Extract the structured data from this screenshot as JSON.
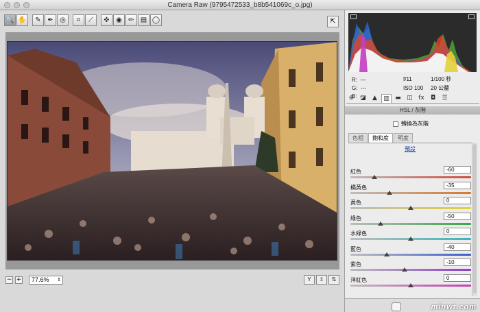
{
  "window": {
    "title": "Camera Raw (9795472533_b8b541069c_o.jpg)"
  },
  "toolbar": {
    "tools": [
      {
        "name": "zoom-tool",
        "glyph": "🔍",
        "active": true
      },
      {
        "name": "hand-tool",
        "glyph": "✋",
        "active": false
      },
      {
        "name": "white-balance-tool",
        "glyph": "✎",
        "active": false
      },
      {
        "name": "color-sampler-tool",
        "glyph": "✒",
        "active": false
      },
      {
        "name": "targeted-adjustment-tool",
        "glyph": "◎",
        "active": false
      },
      {
        "name": "crop-tool",
        "glyph": "⌗",
        "active": false
      },
      {
        "name": "straighten-tool",
        "glyph": "⟋",
        "active": false
      },
      {
        "name": "spot-removal-tool",
        "glyph": "✜",
        "active": false
      },
      {
        "name": "red-eye-tool",
        "glyph": "◉",
        "active": false
      },
      {
        "name": "adjustment-brush-tool",
        "glyph": "✏",
        "active": false
      },
      {
        "name": "graduated-filter-tool",
        "glyph": "▤",
        "active": false
      },
      {
        "name": "radial-filter-tool",
        "glyph": "◯",
        "active": false
      }
    ]
  },
  "status": {
    "zoom": "77.6%"
  },
  "readout": {
    "r": "R:",
    "g": "G:",
    "b": "B:",
    "dash": "---",
    "aperture": "f/11",
    "shutter": "1/100 秒",
    "iso": "ISO 100",
    "focal": "20 公釐"
  },
  "panel": {
    "title": "HSL / 灰階",
    "grayscale": "轉換為灰階",
    "subtabs": [
      "色相",
      "飽和度",
      "明度"
    ],
    "active_subtab": 1,
    "default_link": "預設",
    "sliders": [
      {
        "label": "紅色",
        "value": "-60",
        "fraction": 0.2,
        "gradient": "linear-gradient(90deg,#bdbdbd,#d14b3c)"
      },
      {
        "label": "橘黃色",
        "value": "-35",
        "fraction": 0.325,
        "gradient": "linear-gradient(90deg,#bdbdbd,#d9782b)"
      },
      {
        "label": "黃色",
        "value": "0",
        "fraction": 0.5,
        "gradient": "linear-gradient(90deg,#bdbdbd,#e1d23a)"
      },
      {
        "label": "綠色",
        "value": "-50",
        "fraction": 0.25,
        "gradient": "linear-gradient(90deg,#bdbdbd,#3aa54a)"
      },
      {
        "label": "水綠色",
        "value": "0",
        "fraction": 0.5,
        "gradient": "linear-gradient(90deg,#bdbdbd,#3ab7b7)"
      },
      {
        "label": "藍色",
        "value": "-40",
        "fraction": 0.3,
        "gradient": "linear-gradient(90deg,#bdbdbd,#3b5fd1)"
      },
      {
        "label": "紫色",
        "value": "-10",
        "fraction": 0.45,
        "gradient": "linear-gradient(90deg,#bdbdbd,#8f3dc7)"
      },
      {
        "label": "洋紅色",
        "value": "0",
        "fraction": 0.5,
        "gradient": "linear-gradient(90deg,#bdbdbd,#c93bb0)"
      }
    ]
  },
  "watermark": "minwt.com"
}
